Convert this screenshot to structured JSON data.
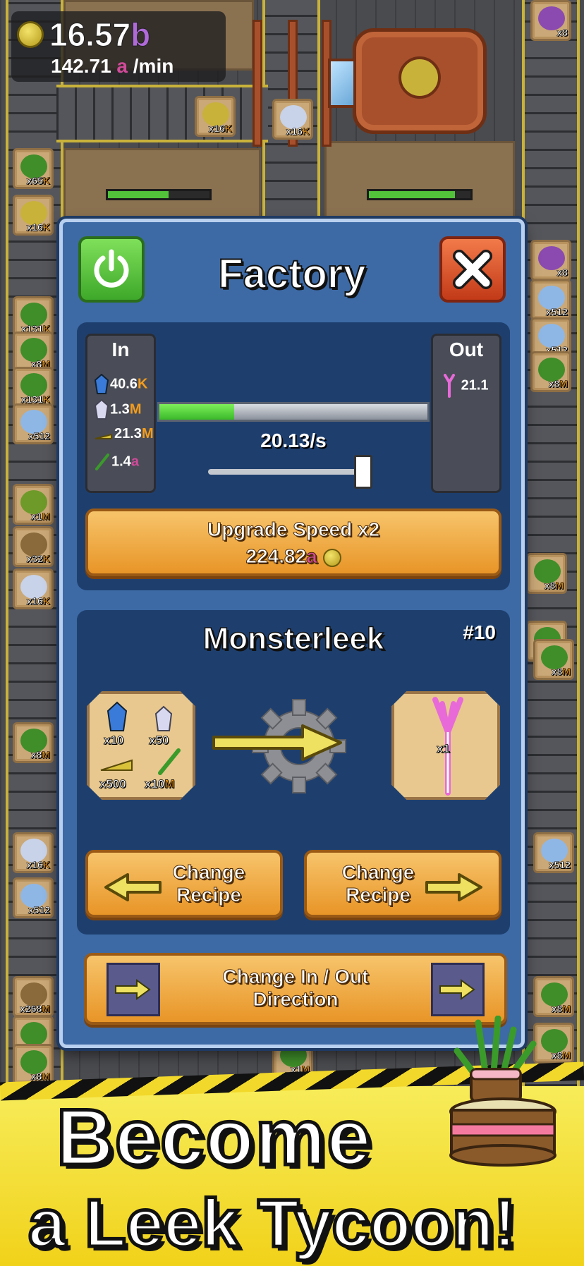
{
  "hud": {
    "coin_icon": "gold-coin-icon",
    "amount": "16.57",
    "amount_suffix": "b",
    "rate": "142.71",
    "rate_suffix": "a",
    "rate_unit": "/min"
  },
  "floor_crates": [
    {
      "count": "x65",
      "suffix": "K",
      "veg": "green-leaf"
    },
    {
      "count": "x16",
      "suffix": "K",
      "veg": "golden-leek"
    },
    {
      "count": "x131",
      "suffix": "K",
      "veg": "lettuce"
    },
    {
      "count": "x8",
      "suffix": "M",
      "veg": "lettuce"
    },
    {
      "count": "x131",
      "suffix": "K",
      "veg": "lettuce"
    },
    {
      "count": "x512",
      "suffix": "",
      "veg": "crystal"
    },
    {
      "count": "x1",
      "suffix": "M",
      "veg": "lettuce"
    },
    {
      "count": "x32",
      "suffix": "K",
      "veg": "barrel"
    },
    {
      "count": "x16",
      "suffix": "K",
      "veg": "crystal"
    },
    {
      "count": "x8",
      "suffix": "M",
      "veg": "lettuce"
    },
    {
      "count": "x16",
      "suffix": "K",
      "veg": "crystal"
    },
    {
      "count": "x512",
      "suffix": "",
      "veg": "crystal"
    },
    {
      "count": "x268",
      "suffix": "M",
      "veg": "barrel"
    },
    {
      "count": "x131",
      "suffix": "K",
      "veg": "lettuce"
    },
    {
      "count": "x8",
      "suffix": "M",
      "veg": "lettuce"
    },
    {
      "count": "x8",
      "suffix": "",
      "veg": "purple-grapes"
    },
    {
      "count": "x8",
      "suffix": "",
      "veg": "purple-grapes"
    },
    {
      "count": "x512",
      "suffix": "",
      "veg": "crystal"
    },
    {
      "count": "x512",
      "suffix": "",
      "veg": "crystal"
    },
    {
      "count": "x8",
      "suffix": "M",
      "veg": "lettuce"
    },
    {
      "count": "x8",
      "suffix": "M",
      "veg": "lettuce"
    },
    {
      "count": "x131",
      "suffix": "K",
      "veg": "lettuce"
    },
    {
      "count": "x8",
      "suffix": "M",
      "veg": "lettuce"
    },
    {
      "count": "x512",
      "suffix": "",
      "veg": "crystal"
    },
    {
      "count": "x8",
      "suffix": "M",
      "veg": "lettuce"
    },
    {
      "count": "x8",
      "suffix": "M",
      "veg": "lettuce"
    },
    {
      "count": "x16",
      "suffix": "K",
      "veg": "golden-leek"
    },
    {
      "count": "x16",
      "suffix": "K",
      "veg": "crystal"
    },
    {
      "count": "x1",
      "suffix": "M",
      "veg": "lettuce"
    }
  ],
  "modal": {
    "title": "Factory",
    "power_icon": "power-icon",
    "close_icon": "close-x-icon",
    "in_label": "In",
    "out_label": "Out",
    "inputs": [
      {
        "icon": "blue-crystal-icon",
        "value": "40.6",
        "suffix": "K",
        "suffix_color": "orange"
      },
      {
        "icon": "white-crystal-icon",
        "value": "1.3",
        "suffix": "M",
        "suffix_color": "orange"
      },
      {
        "icon": "golden-leek-icon",
        "value": "21.3",
        "suffix": "M",
        "suffix_color": "orange"
      },
      {
        "icon": "green-leek-icon",
        "value": "1.4",
        "suffix": "a",
        "suffix_color": "purple"
      }
    ],
    "outputs": [
      {
        "icon": "monsterleek-icon",
        "value": "21.1"
      }
    ],
    "progress": 0.28,
    "rate": "20.13/s",
    "speed_slider": 1.0,
    "upgrade": {
      "label": "Upgrade Speed x2",
      "cost": "224.82",
      "cost_suffix": "a"
    },
    "recipe": {
      "name": "Monsterleek",
      "number": "#10",
      "inputs": [
        {
          "icon": "blue-crystal-icon",
          "qty": "x10",
          "suffix": ""
        },
        {
          "icon": "white-crystal-icon",
          "qty": "x50",
          "suffix": ""
        },
        {
          "icon": "golden-leek-icon",
          "qty": "x500",
          "suffix": ""
        },
        {
          "icon": "green-leek-icon",
          "qty": "x10",
          "suffix": "M"
        }
      ],
      "output": {
        "icon": "monsterleek-icon",
        "qty": "x1"
      },
      "prev_label_1": "Change",
      "prev_label_2": "Recipe",
      "next_label_1": "Change",
      "next_label_2": "Recipe"
    },
    "direction": {
      "label_1": "Change In / Out",
      "label_2": "Direction"
    }
  },
  "banner": {
    "line1": "Become",
    "line2": "a Leek Tycoon!"
  },
  "colors": {
    "panel_blue": "#3d6aa5",
    "panel_dark": "#1e3f6e",
    "button_orange": "#e89527",
    "progress_green": "#52c23a",
    "banner_yellow": "#f1d21a",
    "suffix_orange": "#f39c1d",
    "suffix_purple": "#b06ad8"
  }
}
